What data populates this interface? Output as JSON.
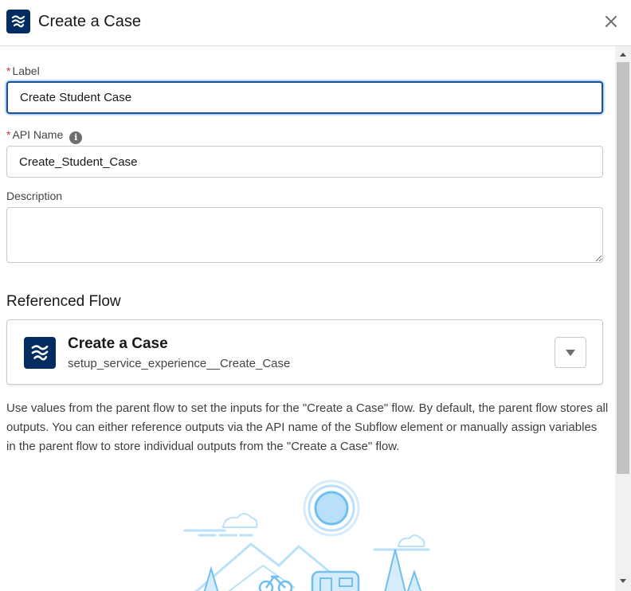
{
  "header": {
    "title": "Create a Case",
    "icon": "flow-icon",
    "close_icon": "close-icon"
  },
  "form": {
    "label": {
      "label": "Label",
      "required_mark": "*",
      "value": "Create Student Case"
    },
    "api_name": {
      "label": "API Name",
      "required_mark": "*",
      "info_icon": "info-icon",
      "info_glyph": "i",
      "value": "Create_Student_Case"
    },
    "description": {
      "label": "Description",
      "value": ""
    }
  },
  "referenced_flow": {
    "section_title": "Referenced Flow",
    "flow_name": "Create a Case",
    "flow_api_name": "setup_service_experience__Create_Case",
    "icon": "flow-icon",
    "dropdown_icon": "chevron-down-icon"
  },
  "help_text": "Use values from the parent flow to set the inputs for the \"Create a Case\" flow. By default, the parent flow stores all outputs. You can either reference outputs via the API name of the Subflow element or manually assign variables in the parent flow to store individual outputs from the \"Create a Case\" flow.",
  "colors": {
    "brand_dark": "#032d60",
    "focus_border": "#1b5297",
    "required": "#c23934",
    "illustration_blue": "#8fd0f7"
  }
}
